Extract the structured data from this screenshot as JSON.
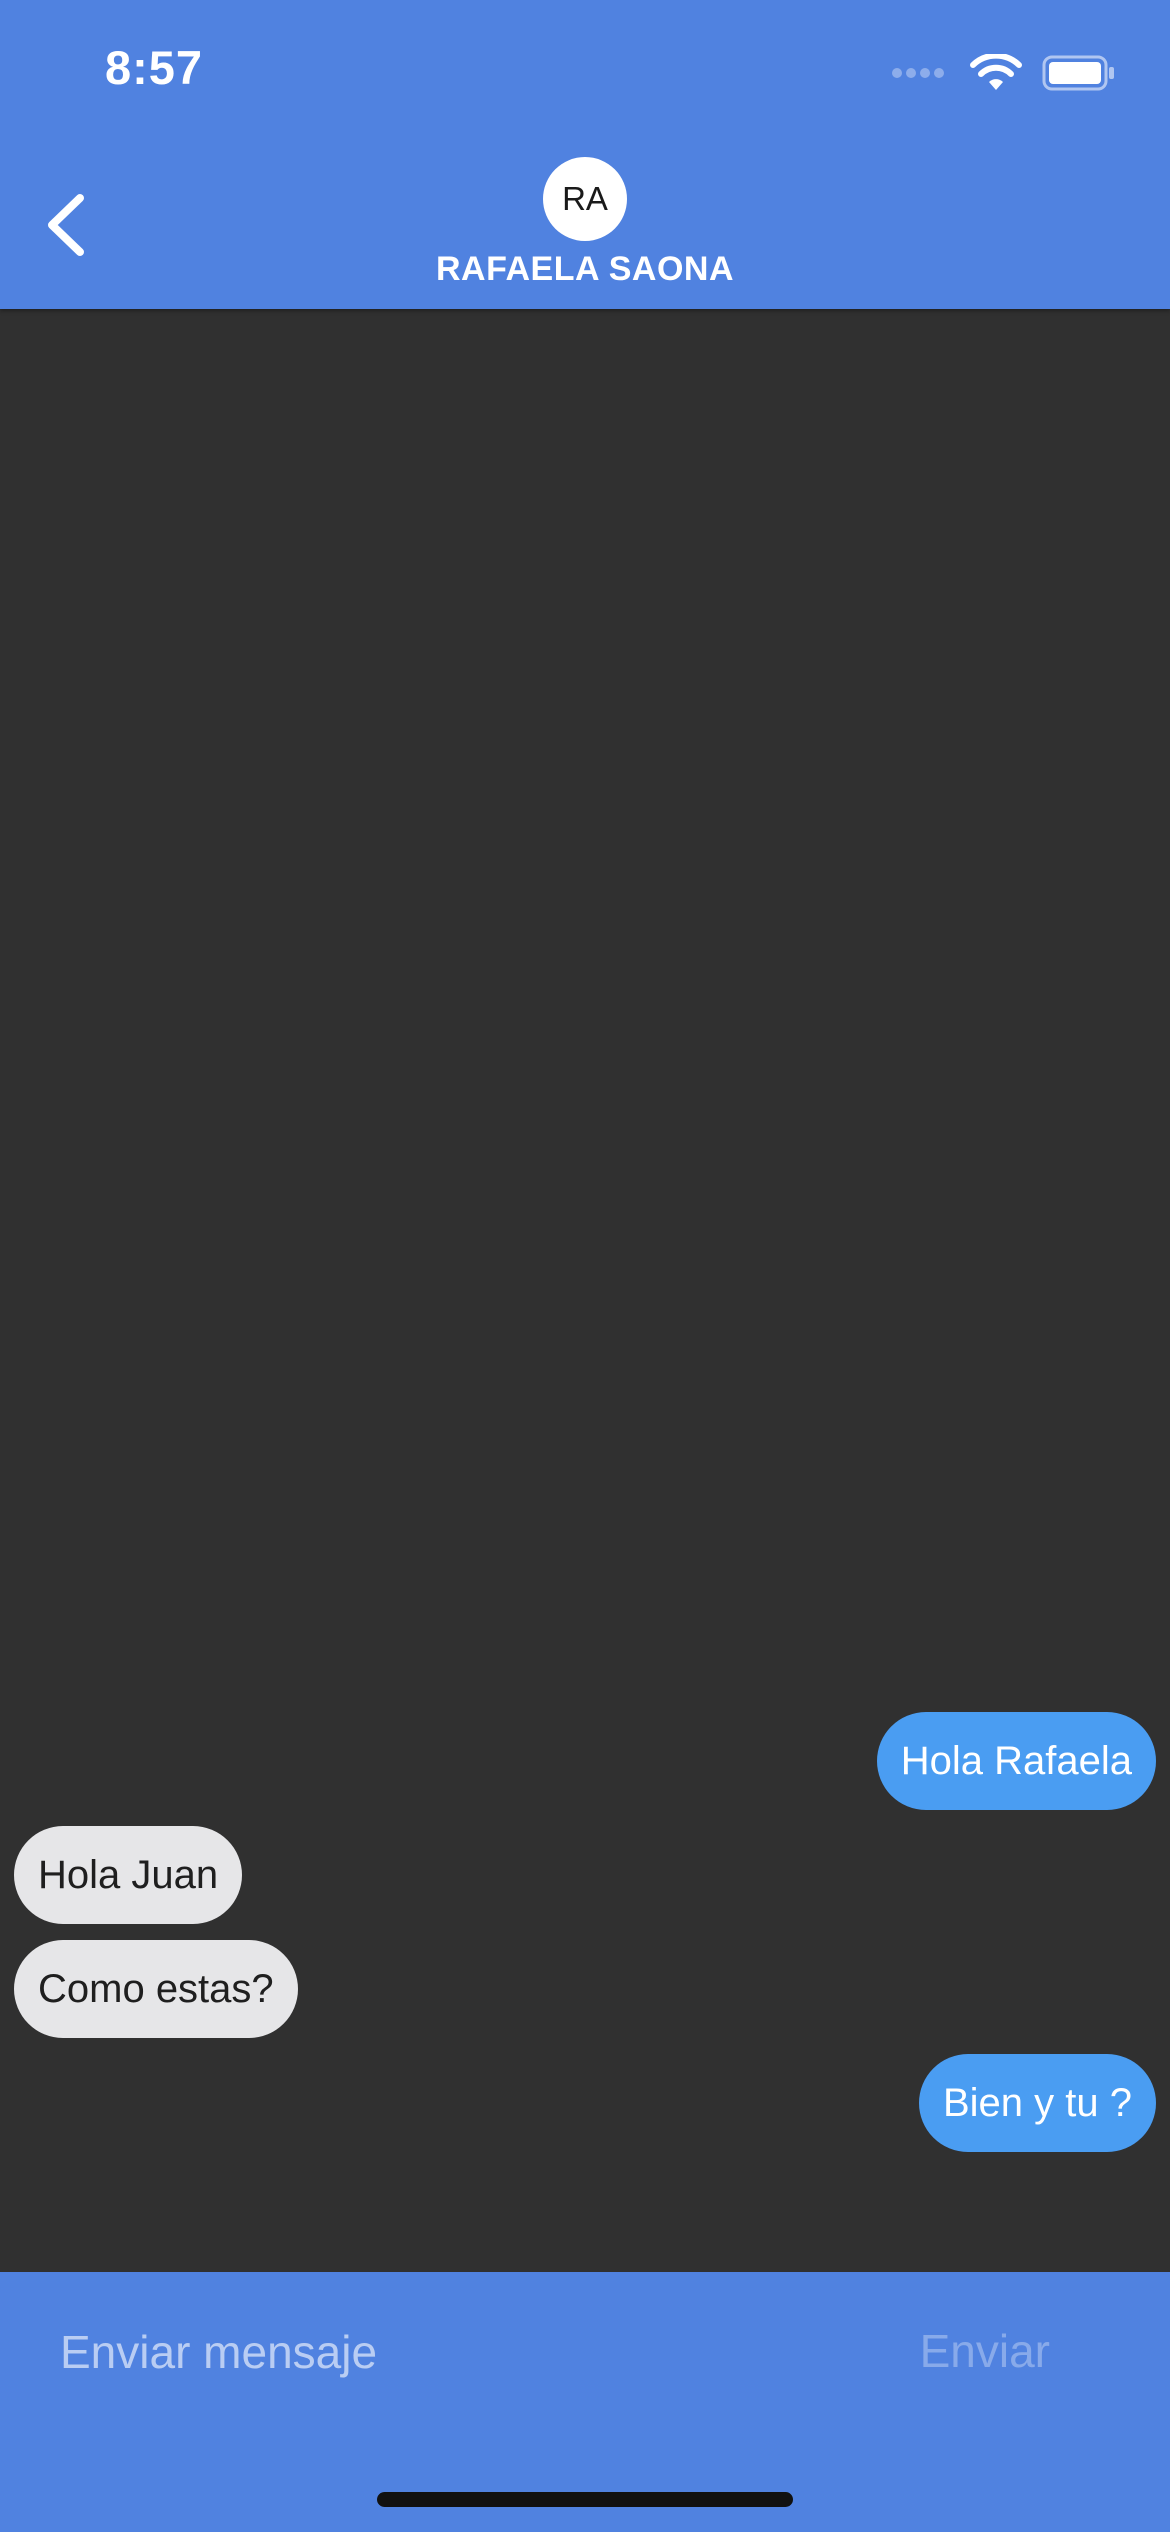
{
  "status_bar": {
    "time": "8:57",
    "icons": [
      "cellular-signal-icon",
      "wifi-icon",
      "battery-icon"
    ]
  },
  "header": {
    "back_icon": "chevron-left-icon",
    "avatar_initials": "RA",
    "contact_name": "RAFAELA SAONA",
    "background_color": "#5082E0"
  },
  "messages": [
    {
      "direction": "outgoing",
      "text": "Hola Rafaela"
    },
    {
      "direction": "incoming",
      "text": "Hola Juan"
    },
    {
      "direction": "incoming",
      "text": "Como estas?"
    },
    {
      "direction": "outgoing",
      "text": "Bien y tu ?"
    }
  ],
  "colors": {
    "outgoing_bubble": "#4A9DF2",
    "incoming_bubble": "#E6E6E8",
    "chat_background": "#303030"
  },
  "composer": {
    "placeholder": "Enviar mensaje",
    "value": "",
    "send_label": "Enviar"
  }
}
